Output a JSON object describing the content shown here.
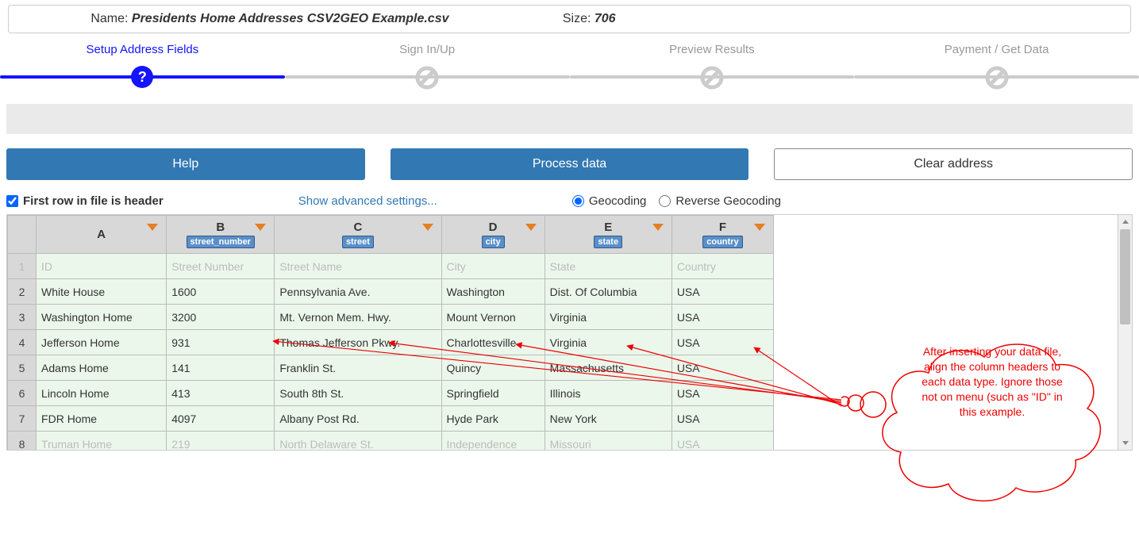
{
  "header": {
    "name_label": "Name: ",
    "name_value": "Presidents Home Addresses CSV2GEO Example.csv",
    "size_label": "Size: ",
    "size_value": "706"
  },
  "steps": [
    {
      "label": "Setup Address Fields",
      "active": true,
      "icon": "help"
    },
    {
      "label": "Sign In/Up",
      "active": false,
      "icon": "disabled"
    },
    {
      "label": "Preview Results",
      "active": false,
      "icon": "disabled"
    },
    {
      "label": "Payment / Get Data",
      "active": false,
      "icon": "disabled"
    }
  ],
  "buttons": {
    "help": "Help",
    "process": "Process data",
    "clear": "Clear address"
  },
  "controls": {
    "first_row_header": "First row in file is header",
    "advanced": "Show advanced settings...",
    "geocoding": "Geocoding",
    "reverse": "Reverse Geocoding"
  },
  "columns": [
    {
      "letter": "A",
      "tag": ""
    },
    {
      "letter": "B",
      "tag": "street_number"
    },
    {
      "letter": "C",
      "tag": "street"
    },
    {
      "letter": "D",
      "tag": "city"
    },
    {
      "letter": "E",
      "tag": "state"
    },
    {
      "letter": "F",
      "tag": "country"
    }
  ],
  "rows": [
    {
      "n": "1",
      "cells": [
        "ID",
        "Street Number",
        "Street Name",
        "City",
        "State",
        "Country"
      ],
      "header": true
    },
    {
      "n": "2",
      "cells": [
        "White House",
        "1600",
        "Pennsylvania Ave.",
        "Washington",
        "Dist. Of Columbia",
        "USA"
      ]
    },
    {
      "n": "3",
      "cells": [
        "Washington Home",
        "3200",
        "Mt. Vernon Mem. Hwy.",
        "Mount Vernon",
        "Virginia",
        "USA"
      ]
    },
    {
      "n": "4",
      "cells": [
        "Jefferson Home",
        "931",
        "Thomas Jefferson Pkwy.",
        "Charlottesville",
        "Virginia",
        "USA"
      ]
    },
    {
      "n": "5",
      "cells": [
        "Adams Home",
        "141",
        "Franklin St.",
        "Quincy",
        "Massachusetts",
        "USA"
      ]
    },
    {
      "n": "6",
      "cells": [
        "Lincoln Home",
        "413",
        "South 8th St.",
        "Springfield",
        "Illinois",
        "USA"
      ]
    },
    {
      "n": "7",
      "cells": [
        "FDR Home",
        "4097",
        "Albany Post Rd.",
        "Hyde Park",
        "New York",
        "USA"
      ]
    },
    {
      "n": "8",
      "cells": [
        "Truman Home",
        "219",
        "North Delaware St.",
        "Independence",
        "Missouri",
        "USA"
      ],
      "last": true
    }
  ],
  "annotation": {
    "text": "After inserting your data file, align the column headers to each data type. Ignore those not on menu (such as \"ID\" in this example."
  }
}
